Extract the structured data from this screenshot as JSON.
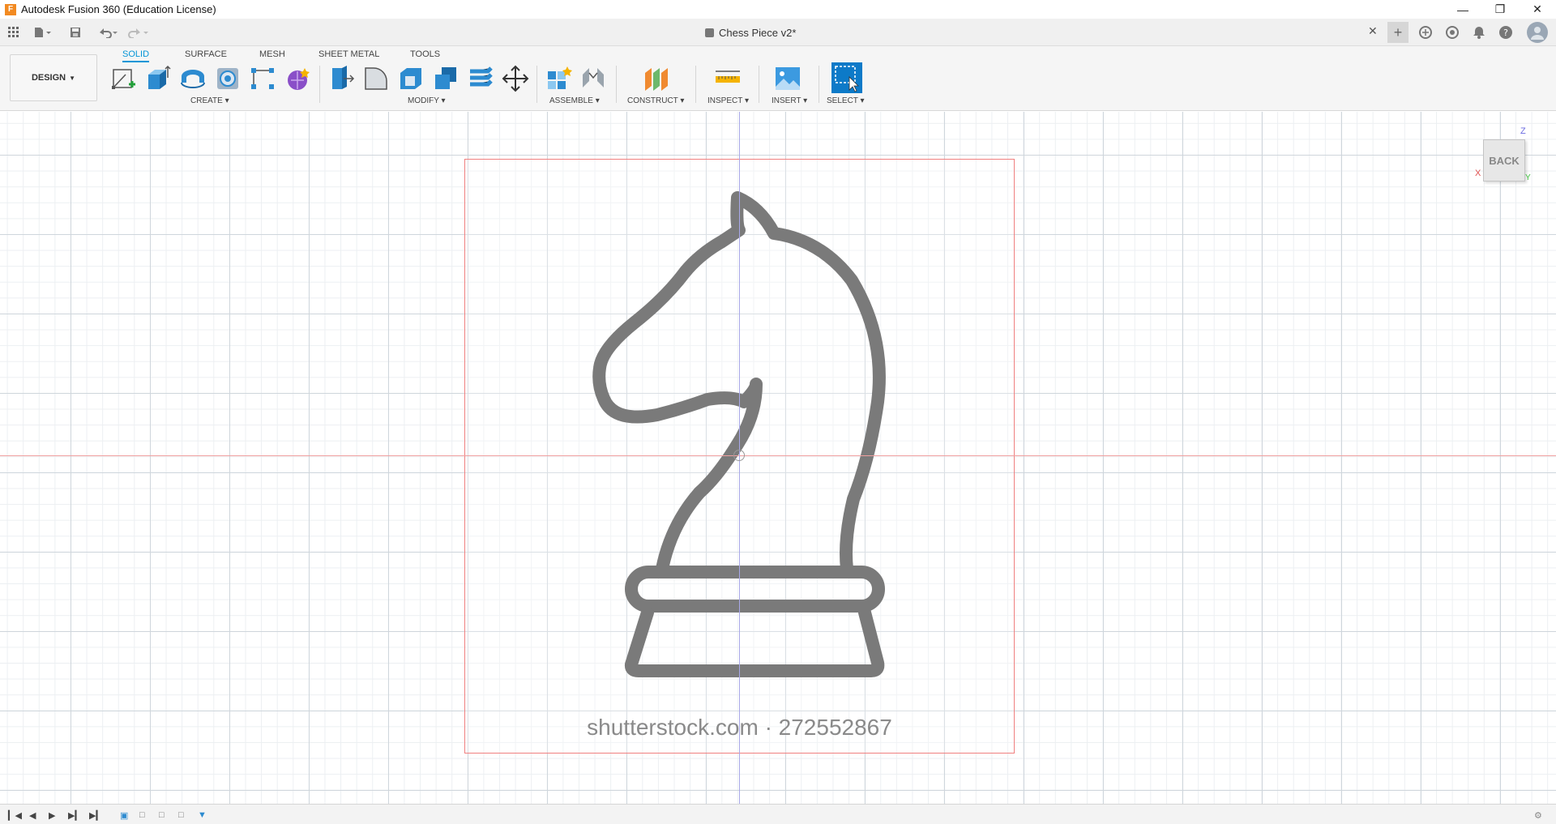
{
  "window": {
    "app_icon": "F",
    "title": "Autodesk Fusion 360 (Education License)",
    "controls": [
      "minimize-icon",
      "restore-icon",
      "close-icon"
    ]
  },
  "quickbar": {
    "document_title": "Chess Piece v2*",
    "icons": [
      "grid-menu-icon",
      "file-icon",
      "save-icon",
      "undo-icon",
      "redo-icon",
      "close-tab-icon",
      "new-tab-icon",
      "extensions-icon",
      "job-status-icon",
      "notifications-icon",
      "help-icon",
      "profile-avatar-icon"
    ]
  },
  "ribbon": {
    "workspace_label": "DESIGN",
    "tabs": [
      "SOLID",
      "SURFACE",
      "MESH",
      "SHEET METAL",
      "TOOLS"
    ],
    "active_tab": "SOLID",
    "groups": {
      "create": "CREATE",
      "modify": "MODIFY",
      "assemble": "ASSEMBLE",
      "construct": "CONSTRUCT",
      "inspect": "INSPECT",
      "insert": "INSERT",
      "select": "SELECT"
    },
    "accent_color": "#0696d7"
  },
  "viewport": {
    "canvas_watermark": "shutterstock.com · 272552867",
    "viewcube": {
      "face_label": "BACK",
      "axis_z": "Z",
      "axis_x": "X",
      "axis_y": "Y"
    }
  },
  "timeline": {
    "icons": [
      "first-step-icon",
      "prev-step-icon",
      "play-icon",
      "next-step-icon",
      "last-step-icon",
      "sketch-feature-icon",
      "canvas-feature-icon",
      "feature-icon",
      "feature-icon",
      "canvas-marker-icon",
      "settings-icon"
    ]
  }
}
